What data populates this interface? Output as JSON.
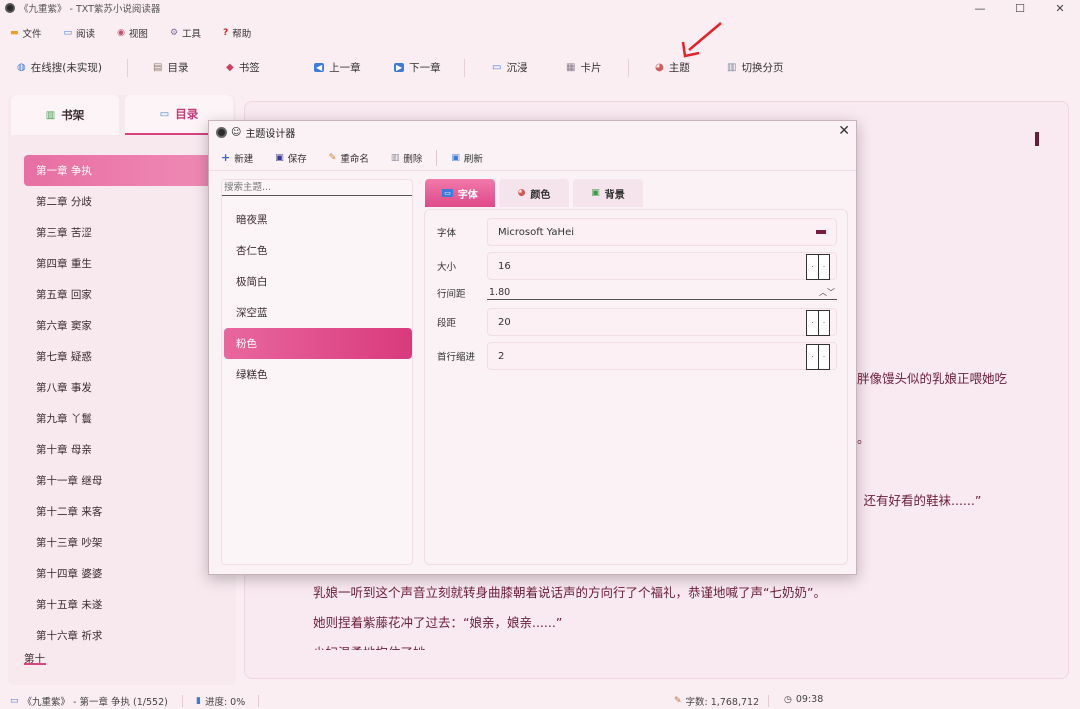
{
  "window": {
    "title": "《九重紫》 - TXT紫苏小说阅读器",
    "controls": [
      "—",
      "☐",
      "✕"
    ]
  },
  "menu": [
    {
      "icon": "folder-icon",
      "glyph": "▬",
      "label": "文件"
    },
    {
      "icon": "book-icon",
      "glyph": "▭",
      "label": "阅读"
    },
    {
      "icon": "eye-icon",
      "glyph": "◉",
      "label": "视图"
    },
    {
      "icon": "gear-icon",
      "glyph": "⚙",
      "label": "工具"
    },
    {
      "icon": "help-icon",
      "glyph": "?",
      "label": "帮助"
    }
  ],
  "toolbar": {
    "online_search": "在线搜(未实现)",
    "toc": "目录",
    "bookmark": "书签",
    "prev_chapter": "上一章",
    "next_chapter": "下一章",
    "immersive": "沉浸",
    "card": "卡片",
    "theme": "主题",
    "toggle_pagination": "切换分页"
  },
  "sidebar": {
    "tabs": [
      {
        "label": "书架",
        "icon": "bookshelf-icon"
      },
      {
        "label": "目录",
        "icon": "toc-book-icon"
      }
    ],
    "chapters": [
      "第一章 争执",
      "第二章 分歧",
      "第三章 苦涩",
      "第四章 重生",
      "第五章 回家",
      "第六章 窦家",
      "第七章 疑惑",
      "第八章 事发",
      "第九章 丫鬟",
      "第十章 母亲",
      "第十一章 继母",
      "第十二章 来客",
      "第十三章 吵架",
      "第十四章 婆婆",
      "第十五章 未遂",
      "第十六章 祈求",
      "第十七章 秋扇"
    ],
    "active_index": 0
  },
  "reader": {
    "lines": [
      "胖像馒头似的乳娘正喂她吃",
      "。",
      "，还有好看的鞋袜......”",
      "乳娘一听到这个声音立刻就转身曲膝朝着说话声的方向行了个福礼，恭谨地喊了声“七奶奶”。",
      "她则捏着紫藤花冲了过去：“娘亲，娘亲......”",
      "少妇温柔地抱住了她"
    ]
  },
  "status": {
    "book_chapter": "《九重紫》 - 第一章 争执 (1/552)",
    "progress": "进度: 0%",
    "word_count": "字数: 1,768,712",
    "time": "09:38"
  },
  "dialog": {
    "title": "主题设计器",
    "toolbar": {
      "new": "新建",
      "save": "保存",
      "rename": "重命名",
      "delete": "删除",
      "refresh": "刷新"
    },
    "search_placeholder": "搜索主题...",
    "themes": [
      "暗夜黑",
      "杏仁色",
      "极简白",
      "深空蓝",
      "粉色",
      "绿糕色"
    ],
    "active_theme_index": 4,
    "tabs": [
      {
        "label": "字体",
        "icon": "font-icon"
      },
      {
        "label": "颜色",
        "icon": "palette-icon"
      },
      {
        "label": "背景",
        "icon": "image-icon"
      }
    ],
    "active_tab_index": 0,
    "fields": {
      "font_label": "字体",
      "font_value": "Microsoft YaHei",
      "size_label": "大小",
      "size_value": "16",
      "line_height_label": "行间距",
      "line_height_value": "1.80",
      "paragraph_spacing_label": "段距",
      "paragraph_spacing_value": "20",
      "indent_label": "首行缩进",
      "indent_value": "2"
    }
  },
  "colors": {
    "accent": "#d8427f",
    "text_dark": "#6b1e3a",
    "bg": "#fbeef3"
  }
}
